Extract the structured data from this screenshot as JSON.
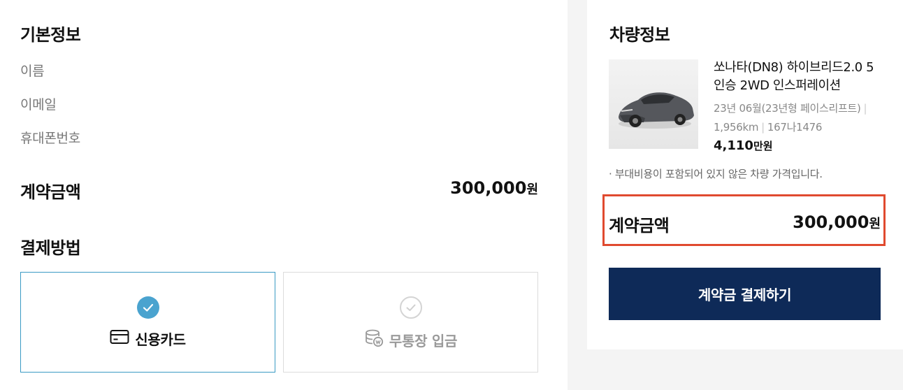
{
  "basic_info": {
    "title": "기본정보",
    "fields": [
      "이름",
      "이메일",
      "휴대폰번호"
    ]
  },
  "contract": {
    "label": "계약금액",
    "amount": "300,000",
    "unit": "원"
  },
  "payment": {
    "title": "결제방법",
    "methods": [
      {
        "label": "신용카드",
        "selected": true,
        "icon": "credit-card-icon"
      },
      {
        "label": "무통장 입금",
        "selected": false,
        "icon": "coins-icon"
      }
    ]
  },
  "vehicle": {
    "title": "차량정보",
    "name": "쏘나타(DN8) 하이브리드2.0 5인승 2WD 인스퍼레이션",
    "year": "23년 06월(23년형 페이스리프트)",
    "mileage": "1,956km",
    "plate": "167나1476",
    "price": "4,110",
    "price_unit": "만원",
    "notice": "·  부대비용이 포함되어 있지 않은 차량 가격입니다."
  },
  "summary": {
    "label": "계약금액",
    "amount": "300,000",
    "unit": "원"
  },
  "cta": {
    "label": "계약금 결제하기"
  },
  "colors": {
    "accent": "#0e2a58",
    "check": "#4aa3cf",
    "highlight": "#e04a2f"
  }
}
